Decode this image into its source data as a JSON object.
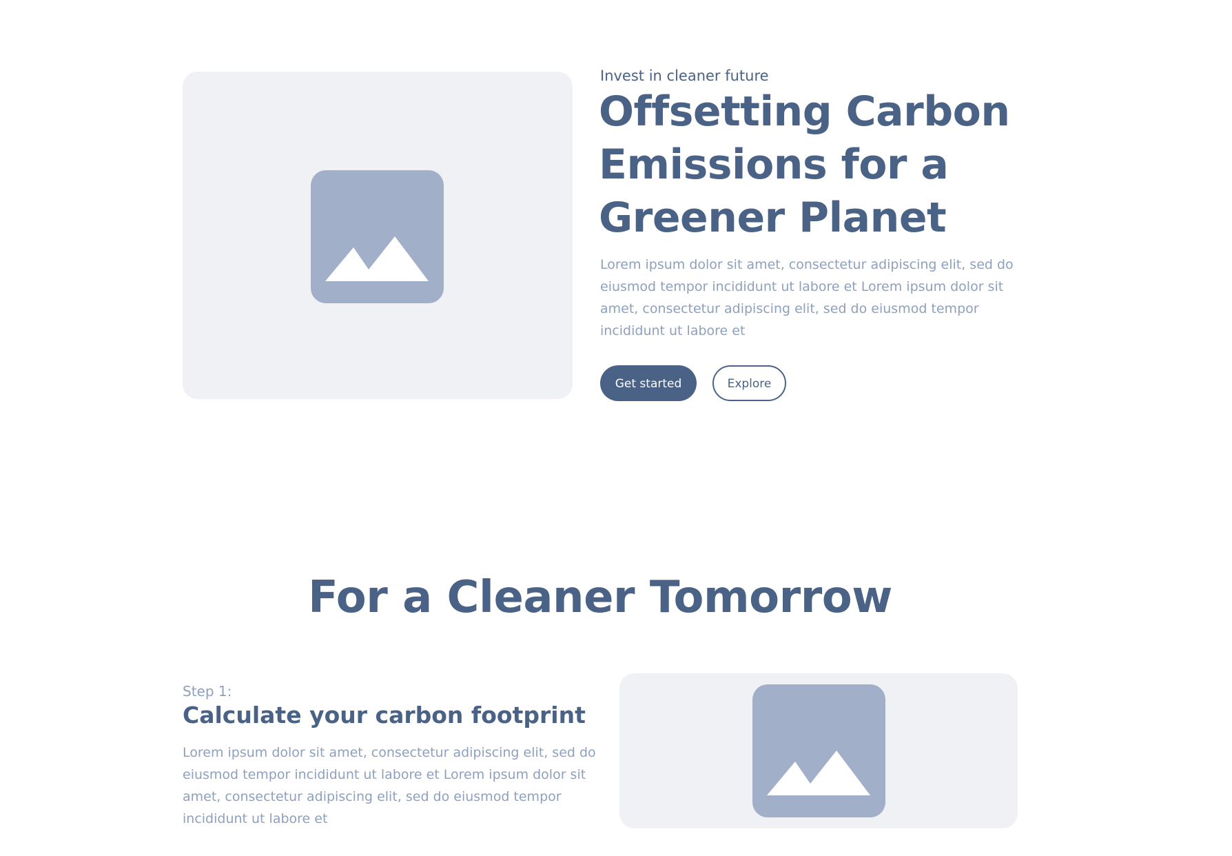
{
  "hero": {
    "eyebrow": "Invest in cleaner future",
    "title": "Offsetting Carbon Emissions for a Greener Planet",
    "body": "Lorem ipsum dolor sit amet, consectetur adipiscing elit, sed do eiusmod tempor incididunt ut labore et Lorem ipsum dolor sit amet, consectetur adipiscing elit, sed do eiusmod tempor incididunt ut labore et",
    "primary_button": "Get started",
    "secondary_button": "Explore",
    "image_icon": "image-placeholder-icon"
  },
  "section": {
    "title": "For a Cleaner Tomorrow"
  },
  "step": {
    "label": "Step 1:",
    "title": "Calculate your carbon footprint",
    "body": "Lorem ipsum dolor sit amet, consectetur adipiscing elit, sed do eiusmod tempor incididunt ut labore et Lorem ipsum dolor sit amet, consectetur adipiscing elit, sed do eiusmod tempor incididunt ut labore et",
    "image_icon": "image-placeholder-icon"
  },
  "colors": {
    "primary": "#4a6285",
    "muted_text": "#8ea0bd",
    "card_bg": "#f0f1f5",
    "placeholder": "#a1afc9"
  }
}
